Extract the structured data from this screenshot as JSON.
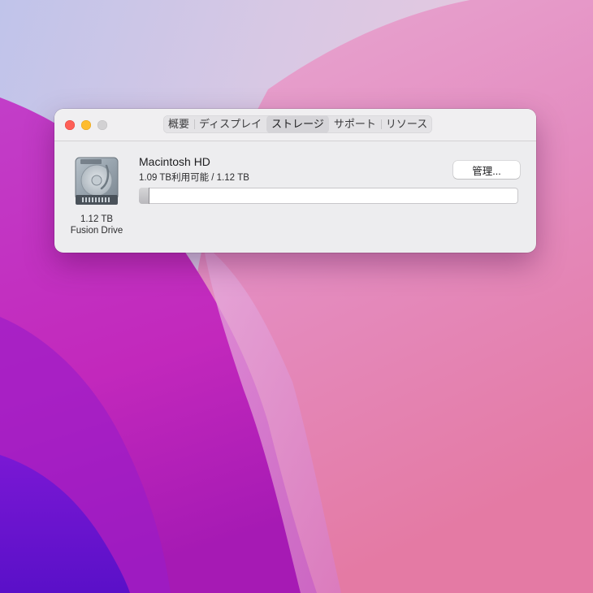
{
  "window": {
    "tabs": [
      {
        "label": "概要",
        "active": false
      },
      {
        "label": "ディスプレイ",
        "active": false
      },
      {
        "label": "ストレージ",
        "active": true
      },
      {
        "label": "サポート",
        "active": false
      },
      {
        "label": "リソース",
        "active": false
      }
    ]
  },
  "storage": {
    "disk_icon": "hard-drive-icon",
    "disk_size": "1.12 TB",
    "disk_type": "Fusion Drive",
    "volume_name": "Macintosh HD",
    "availability": "1.09 TB利用可能 / 1.12 TB",
    "manage_label": "管理...",
    "used_fraction": 0.027
  },
  "colors": {
    "close": "#fe5f57",
    "minimize": "#febc2e",
    "zoom_disabled": "#d2d1d3",
    "window_bg": "#ededef"
  }
}
